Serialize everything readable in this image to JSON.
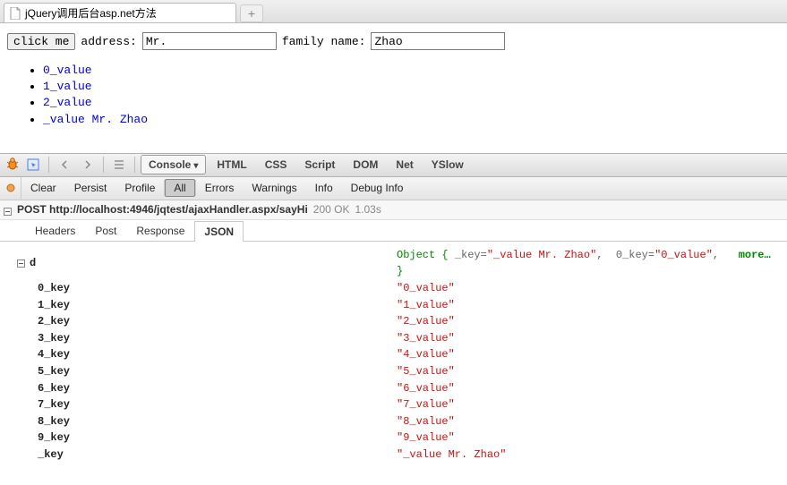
{
  "browser": {
    "tab_title": "jQuery调用后台asp.net方法",
    "new_tab_glyph": "+"
  },
  "page": {
    "button_label": "click me",
    "address_label": "address:",
    "address_value": "Mr.",
    "familyname_label": "family name:",
    "familyname_value": "Zhao",
    "list_items": [
      "0_value",
      "1_value",
      "2_value",
      "_value Mr. Zhao"
    ]
  },
  "devtools": {
    "panel_tabs": {
      "console": "Console",
      "html": "HTML",
      "css": "CSS",
      "script": "Script",
      "dom": "DOM",
      "net": "Net",
      "yslow": "YSlow"
    },
    "console_toolbar": {
      "clear": "Clear",
      "persist": "Persist",
      "profile": "Profile",
      "all": "All",
      "errors": "Errors",
      "warnings": "Warnings",
      "info": "Info",
      "debug_info": "Debug Info"
    },
    "request": {
      "method": "POST",
      "url": "http://localhost:4946/jqtest/ajaxHandler.aspx/sayHi",
      "status": "200 OK",
      "time": "1.03s"
    },
    "subtabs": {
      "headers": "Headers",
      "post": "Post",
      "response": "Response",
      "json": "JSON"
    },
    "json": {
      "root_key": "d",
      "root_summary_prefix": "Object",
      "root_summary": "{  _key=\"_value Mr. Zhao\",  0_key=\"0_value\",  more…}",
      "rows": [
        {
          "key": "0_key",
          "value": "\"0_value\""
        },
        {
          "key": "1_key",
          "value": "\"1_value\""
        },
        {
          "key": "2_key",
          "value": "\"2_value\""
        },
        {
          "key": "3_key",
          "value": "\"3_value\""
        },
        {
          "key": "4_key",
          "value": "\"4_value\""
        },
        {
          "key": "5_key",
          "value": "\"5_value\""
        },
        {
          "key": "6_key",
          "value": "\"6_value\""
        },
        {
          "key": "7_key",
          "value": "\"7_value\""
        },
        {
          "key": "8_key",
          "value": "\"8_value\""
        },
        {
          "key": "9_key",
          "value": "\"9_value\""
        },
        {
          "key": "_key",
          "value": "\"_value Mr. Zhao\""
        }
      ]
    }
  }
}
